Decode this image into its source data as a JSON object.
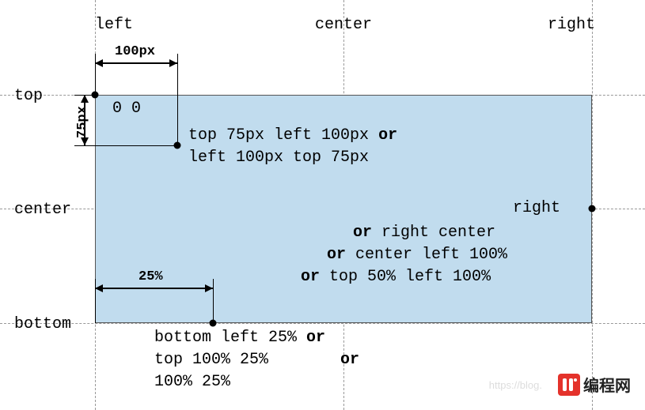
{
  "axis": {
    "left": "left",
    "center_h": "center",
    "right": "right",
    "top": "top",
    "center_v": "center",
    "bottom": "bottom"
  },
  "dims": {
    "w100": "100px",
    "h75": "75px",
    "p25": "25%"
  },
  "points": {
    "origin": "0 0",
    "topleft_a": "top 75px left 100px",
    "topleft_b": "left 100px top 75px",
    "right_a": "right",
    "right_b": "right center",
    "right_c": "center left 100%",
    "right_d": "top 50% left 100%",
    "bottom_a": "bottom left 25%",
    "bottom_b": "top 100% 25%",
    "bottom_c": "100% 25%"
  },
  "kw": {
    "or1": "or",
    "or2": "or",
    "or3": "or",
    "or4": "or",
    "or5": "or",
    "or6": "or"
  },
  "logo": {
    "text": "编程网"
  },
  "faint_url": "https://blog."
}
